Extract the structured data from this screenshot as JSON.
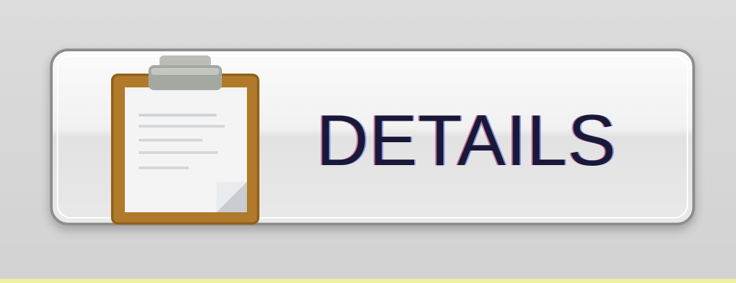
{
  "details_button": {
    "label": "DETAILS",
    "icon": "clipboard-icon"
  },
  "colors": {
    "background": "#d6d6d6",
    "button_border": "#8e8e8e",
    "clipboard_frame": "#b07a2a",
    "clip_metal": "#a3a8a0",
    "label_text": "#1a1838"
  }
}
